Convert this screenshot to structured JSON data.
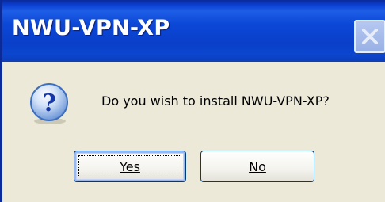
{
  "dialog": {
    "title": "NWU-VPN-XP",
    "message": "Do you wish to install NWU-VPN-XP?",
    "icon": "question-icon",
    "buttons": {
      "yes_label": "Yes",
      "no_label": "No"
    }
  },
  "colors": {
    "titlebar": "#0b47d6",
    "client_background": "#ece9d8",
    "title_text": "#ffffff"
  }
}
